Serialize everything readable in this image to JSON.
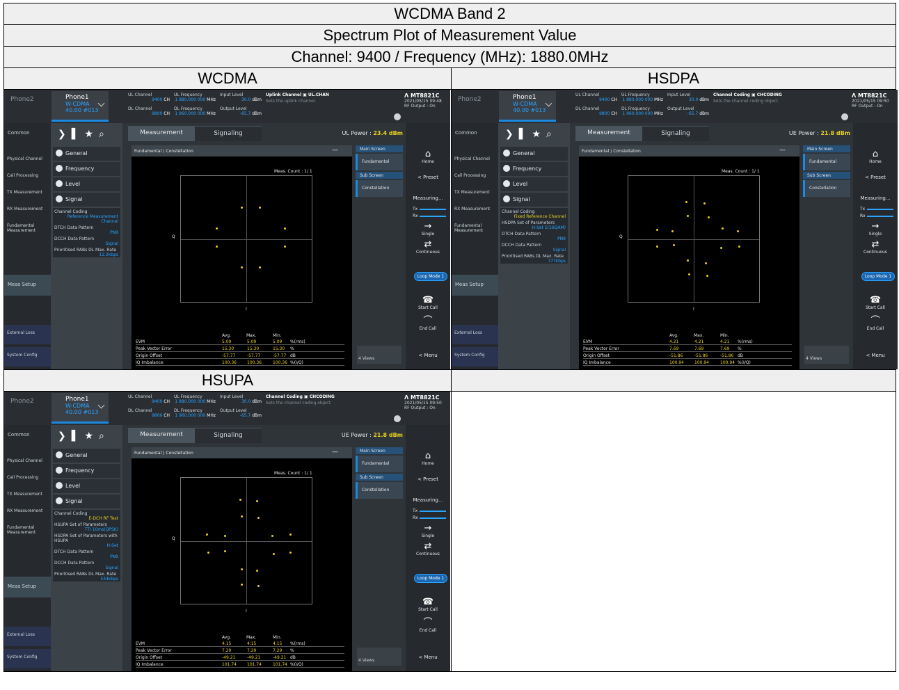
{
  "header": {
    "band": "WCDMA Band 2",
    "plot_title": "Spectrum Plot of Measurement Value",
    "channel_line": "Channel: 9400 / Frequency (MHz): 1880.0MHz",
    "col1": "WCDMA",
    "col2": "HSDPA",
    "col3": "HSUPA"
  },
  "common": {
    "phone2": "Phone2",
    "phone1": "Phone1",
    "mode": "W-CDMA",
    "mode_sub": "40.00 #013",
    "ul_channel": "UL Channel",
    "ul_ch_val": "9400",
    "ch_unit": "CH",
    "ul_freq": "UL Frequency",
    "ul_freq_val": "1 880.000 000",
    "mhz": "MHz",
    "input_level": "Input Level",
    "dl_channel": "DL Channel",
    "dl_ch_val": "9800",
    "dl_freq": "DL Frequency",
    "dl_freq_val": "1 960.000 000",
    "output_level": "Output Level",
    "output_val": "-65.7",
    "dbm": "dBm",
    "mt": "MT8821C",
    "rf_output": "RF Output : On",
    "common_label": "Common",
    "left_items": [
      "Physical Channel",
      "Call Processing",
      "TX Measurement",
      "RX Measurement",
      "Fundamental Measurement"
    ],
    "meas_setup": "Meas Setup",
    "external_loss": "External Loss",
    "system_config": "System Config",
    "menu_general": "General",
    "menu_frequency": "Frequency",
    "menu_level": "Level",
    "menu_signal": "Signal",
    "tab_measurement": "Measurement",
    "tab_signaling": "Signaling",
    "breadcrumb": "Fundamental ⟩ Constellation",
    "meas_count_label": "Meas. Count :",
    "meas_count_val": "1/",
    "meas_count_total": "1",
    "q_label": "Q",
    "i_label": "I",
    "avg": "Avg.",
    "max": "Max.",
    "min": "Min.",
    "row_names": [
      "EVM",
      "Peak Vector Error",
      "Origin Offset",
      "IQ Imbalance"
    ],
    "main_screen": "Main Screen",
    "fundamental": "Fundamental",
    "sub_screen": "Sub Screen",
    "constellation": "Constellation",
    "views": "4 Views",
    "home": "Home",
    "preset": "< Preset",
    "measuring": "Measuring...",
    "tx": "Tx",
    "rx": "Rx",
    "single": "Single",
    "continuous": "Continuous",
    "loop_mode": "Loop Mode 1",
    "start_call": "Start Call",
    "end_call": "End Call",
    "menu": "< Menu",
    "colors": {
      "accent": "#1a8be0",
      "value_yellow": "#e8d020",
      "panel": "#2f3438"
    }
  },
  "panels": [
    {
      "id": "wcdma",
      "input_val": "30.0",
      "input_unit": "dBm",
      "hint_title": "Uplink Channel",
      "hint_code": "UL.CHAN",
      "hint_sub": "Sets the uplink channel.",
      "datetime": "2021/05/15 09:48",
      "power_label": "UL Power :",
      "power_val": "23.4 dBm",
      "signal_items": [
        {
          "k": "Channel Coding",
          "v": "Reference Measurement Channel"
        },
        {
          "k": "DTCH Data Pattern",
          "v": "PN9"
        },
        {
          "k": "DCCH Data Pattern",
          "v": "Signal"
        },
        {
          "k": "Prioritised RABs DL Max. Rate",
          "v": "12.2kbps"
        }
      ],
      "stats": [
        [
          "5.09",
          "5.09",
          "5.09",
          "%(rms)"
        ],
        [
          "15.30",
          "15.30",
          "15.30",
          "%"
        ],
        [
          "-57.77",
          "-57.77",
          "-57.77",
          "dB"
        ],
        [
          "100.36",
          "100.36",
          "100.36",
          "%(I/Q)"
        ]
      ]
    },
    {
      "id": "hsdpa",
      "input_val": "30.0",
      "input_unit": "dBm",
      "hint_title": "Channel Coding",
      "hint_code": "CHCODING",
      "hint_sub": "Sets the channel coding object.",
      "datetime": "2021/05/15 09:50",
      "power_label": "UE Power :",
      "power_val": "21.8 dBm",
      "signal_items": [
        {
          "k": "Channel Coding",
          "v": "Fixed Reference Channel"
        },
        {
          "k": "HSDPA Set of Parameters",
          "v": "H-Set 1(16QAM)"
        },
        {
          "k": "DTCH Data Pattern",
          "v": "PN9"
        },
        {
          "k": "DCCH Data Pattern",
          "v": "Signal"
        },
        {
          "k": "Prioritised RABs DL Max. Rate",
          "v": "777kbps"
        }
      ],
      "stats": [
        [
          "4.21",
          "4.21",
          "4.21",
          "%(rms)"
        ],
        [
          "7.69",
          "7.69",
          "7.69",
          "%"
        ],
        [
          "-51.86",
          "-51.86",
          "-51.86",
          "dB"
        ],
        [
          "100.94",
          "100.94",
          "100.94",
          "%(I/Q)"
        ]
      ]
    },
    {
      "id": "hsupa",
      "input_val": "30.0",
      "input_unit": "dBm",
      "hint_title": "Channel Coding",
      "hint_code": "CHCODING",
      "hint_sub": "Sets the channel coding object.",
      "datetime": "2021/05/15 09:50",
      "power_label": "UE Power :",
      "power_val": "21.8 dBm",
      "signal_items": [
        {
          "k": "Channel Coding",
          "v": "E-DCH RF Test"
        },
        {
          "k": "HSUPA Set of Parameters",
          "v": "TTI 10ms(QPSK)"
        },
        {
          "k": "HSDPA Set of Parameters with HSUPA",
          "v": "H-Set"
        },
        {
          "k": "DTCH Data Pattern",
          "v": "PN9"
        },
        {
          "k": "DCCH Data Pattern",
          "v": "Signal"
        },
        {
          "k": "Prioritised RABs DL Max. Rate",
          "v": "534kbps"
        }
      ],
      "stats": [
        [
          "4.15",
          "4.15",
          "4.15",
          "%(rms)"
        ],
        [
          "7.29",
          "7.29",
          "7.29",
          "%"
        ],
        [
          "-49.21",
          "-49.21",
          "-49.21",
          "dB"
        ],
        [
          "101.74",
          "101.74",
          "101.74",
          "%(I/Q)"
        ]
      ]
    }
  ]
}
